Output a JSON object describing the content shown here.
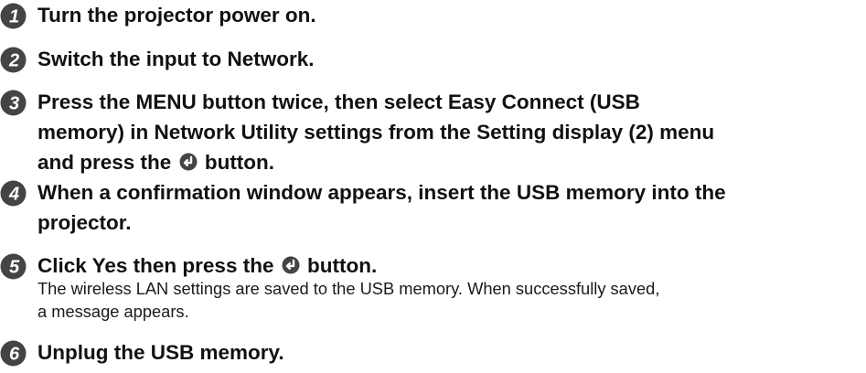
{
  "steps": [
    {
      "number": "1",
      "icon": "circled-number-1-icon",
      "lines": [
        "Turn the projector power on."
      ]
    },
    {
      "number": "2",
      "icon": "circled-number-2-icon",
      "lines": [
        "Switch the input to Network."
      ]
    },
    {
      "number": "3",
      "icon": "circled-number-3-icon",
      "lines": [
        "Press the MENU button twice, then select Easy Connect (USB",
        "memory) in Network Utility settings from the Setting display (2) menu"
      ],
      "last_line_before": "and press the",
      "last_line_after": "button."
    },
    {
      "number": "4",
      "icon": "circled-number-4-icon",
      "lines": [
        "When a confirmation window appears, insert the USB memory into the",
        "projector."
      ]
    },
    {
      "number": "5",
      "icon": "circled-number-5-icon",
      "title_before": "Click Yes then press the",
      "title_after": "button.",
      "description": [
        "The wireless LAN settings are saved to the USB memory. When successfully saved,",
        "a message appears."
      ]
    },
    {
      "number": "6",
      "icon": "circled-number-6-icon",
      "lines": [
        "Unplug the USB memory."
      ]
    }
  ],
  "inline_icon": "enter-button-icon",
  "colors": {
    "icon_fill": "#444444",
    "icon_text": "#ffffff",
    "text": "#111111"
  }
}
